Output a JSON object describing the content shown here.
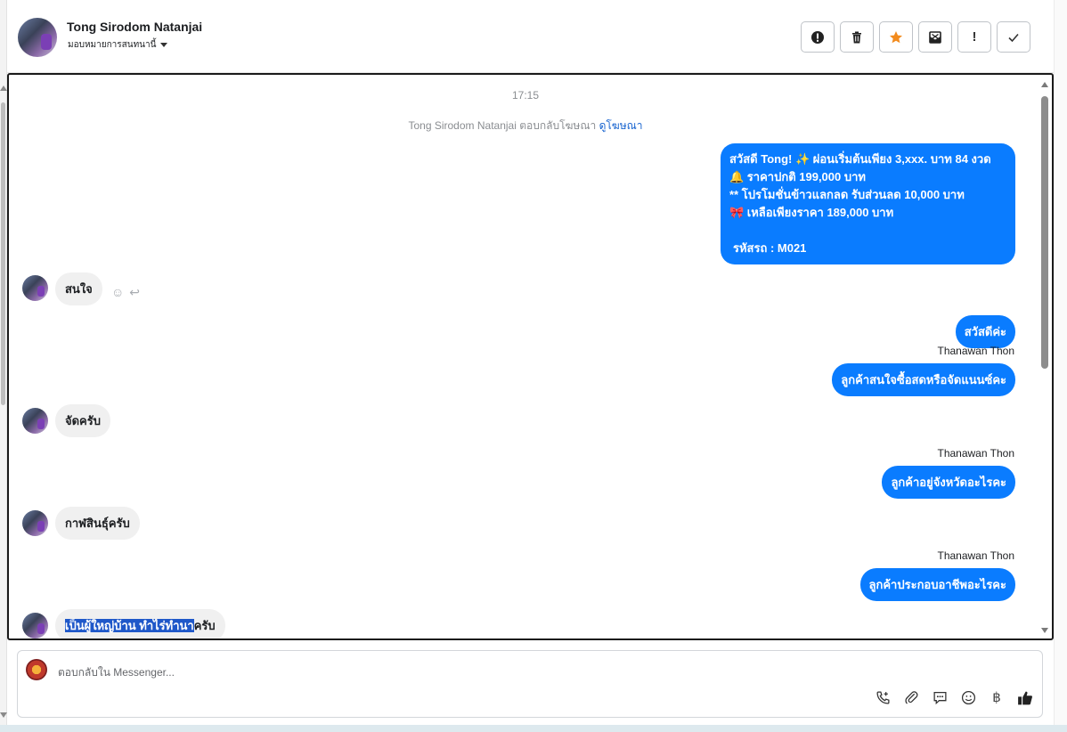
{
  "header": {
    "name": "Tong Sirodom Natanjai",
    "assign_label": "มอบหมายการสนทนานี้"
  },
  "actions": [
    {
      "icon": "alert-circle-icon",
      "glyph": "!"
    },
    {
      "icon": "trash-icon",
      "glyph": ""
    },
    {
      "icon": "star-icon",
      "glyph": "★"
    },
    {
      "icon": "mail-block-icon",
      "glyph": ""
    },
    {
      "icon": "exclamation-icon",
      "glyph": "!"
    },
    {
      "icon": "check-icon",
      "glyph": "✓"
    }
  ],
  "conversation": {
    "timestamp": "17:15",
    "reply_note_text": "Tong Sirodom Natanjai ตอบกลับโฆษณา",
    "reply_note_link": "ดูโฆษณา",
    "ad_message": {
      "line1": "สวัสดี Tong! ✨  ผ่อนเริ่มต้นเพียง 3,xxx. บาท 84 งวด",
      "line2": "🔔 ราคาปกติ 199,000 บาท",
      "line3": "** โปรโมชั่นข้าวแลกลด รับส่วนลด 10,000 บาท",
      "line4": "🎀  เหลือเพียงราคา 189,000 บาท",
      "line5": "รหัสรถ : M021"
    },
    "in_1": "สนใจ",
    "out_1": "สวัสดีค่ะ",
    "sender_1": "Thanawan Thon",
    "out_2": "ลูกค้าสนใจซื้อสดหรือจัดแนนซ์คะ",
    "in_2": "จัดครับ",
    "sender_2": "Thanawan Thon",
    "out_3": "ลูกค้าอยู่จังหวัดอะไรคะ",
    "in_3": "กาฬสินธุ์ครับ",
    "sender_3": "Thanawan Thon",
    "out_4": "ลูกค้าประกอบอาชีพอะไรคะ",
    "in_4_highlighted": "เป็นผู้ใหญ่บ้าน ทำไร่ทำนา",
    "in_4_rest": "ครับ"
  },
  "composer": {
    "placeholder": "ตอบกลับใน Messenger..."
  },
  "colors": {
    "outgoing_bubble": "#0a7cff",
    "incoming_bubble": "#f0f0f0",
    "star": "#f28b1e",
    "link": "#1763cf"
  }
}
